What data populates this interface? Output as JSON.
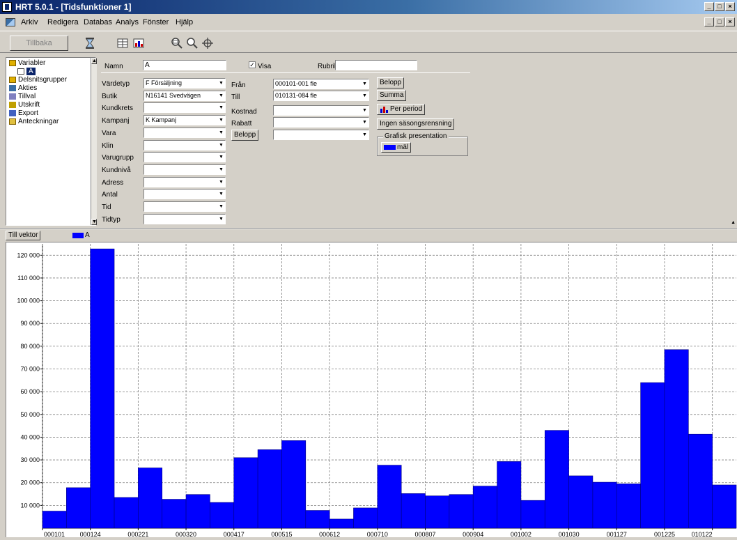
{
  "window": {
    "title": "HRT 5.0.1 - [Tidsfunktioner 1]",
    "controls": [
      "_",
      "□",
      "×"
    ]
  },
  "menu": [
    "Arkiv",
    "Redigera",
    "Databas",
    "Analys",
    "Fönster",
    "Hjälp"
  ],
  "toolbar": {
    "back_label": "Tillbaka"
  },
  "sidebar": {
    "items": [
      {
        "label": "Variabler",
        "icon": "folder-icon"
      },
      {
        "label": "A",
        "icon": "grid-icon",
        "selected": true
      },
      {
        "label": "Delsnitsgrupper",
        "icon": "folder-icon"
      },
      {
        "label": "Akties",
        "icon": "chart-icon"
      },
      {
        "label": "Tillval",
        "icon": "tool-icon"
      },
      {
        "label": "Utskrift",
        "icon": "printer-icon"
      },
      {
        "label": "Export",
        "icon": "export-icon"
      },
      {
        "label": "Anteckningar",
        "icon": "note-icon"
      }
    ]
  },
  "form": {
    "name_label": "Namn",
    "name_value": "A",
    "visa_label": "Visa",
    "visa_checked": true,
    "rubrik_label": "Rubrik",
    "rubrik_value": "",
    "fields": [
      {
        "label": "Värdetyp",
        "value": "F Försäljning"
      },
      {
        "label": "Butik",
        "value": "N16141 Svedvägen"
      },
      {
        "label": "Kundkrets",
        "value": ""
      },
      {
        "label": "Kampanj",
        "value": "K Kampanj"
      },
      {
        "label": "Vara",
        "value": ""
      },
      {
        "label": "Klin",
        "value": ""
      },
      {
        "label": "Varugrupp",
        "value": ""
      },
      {
        "label": "Kundnivå",
        "value": ""
      },
      {
        "label": "Adress",
        "value": ""
      },
      {
        "label": "Antal",
        "value": ""
      },
      {
        "label": "Tid",
        "value": ""
      },
      {
        "label": "Tidtyp",
        "value": ""
      }
    ],
    "fran_label": "Från",
    "fran_value": "000101-001 fle",
    "till_label": "Till",
    "till_value": "010131-084 fle",
    "kostnad_label": "Kostnad",
    "kostnad_value": "",
    "rabatt_label": "Rabatt",
    "rabatt_value": "",
    "belopp_label": "Belopp",
    "belopp_value": "",
    "btn_belopp": "Belopp",
    "btn_summa": "Summa",
    "btn_per_period": "Per period",
    "btn_ingen": "Ingen säsongsrensning",
    "group_title": "Grafisk presentation",
    "swatch_label": "mäl"
  },
  "strip": {
    "button_label": "Till vektor",
    "legend_label": "A"
  },
  "colors": {
    "bar": "#0000ff",
    "selection": "#0a246a",
    "face": "#d4d0c8"
  },
  "chart_data": {
    "type": "bar",
    "title": "",
    "xlabel": "",
    "ylabel": "",
    "ylim": [
      0,
      125000
    ],
    "yticks": [
      10000,
      20000,
      30000,
      40000,
      50000,
      60000,
      70000,
      80000,
      90000,
      100000,
      110000,
      120000
    ],
    "ytick_labels": [
      "10 000",
      "20 000",
      "30 000",
      "40 000",
      "50 000",
      "60 000",
      "70 000",
      "80 000",
      "90 000",
      "100 000",
      "110 000",
      "120 000"
    ],
    "grid": true,
    "xtick_labels": [
      "000101",
      "000124",
      "000221",
      "000320",
      "000417",
      "000515",
      "000612",
      "000710",
      "000807",
      "000904",
      "001002",
      "001030",
      "001127",
      "001225",
      "010122"
    ],
    "series": [
      {
        "name": "A",
        "color": "#0000ff",
        "values": [
          7500,
          17800,
          122800,
          13500,
          26500,
          12700,
          14800,
          11300,
          31000,
          34500,
          38500,
          7800,
          4000,
          8900,
          27700,
          15200,
          14200,
          14800,
          18500,
          29300,
          12200,
          43000,
          23000,
          20200,
          19500,
          64000,
          78500,
          41300,
          19000
        ]
      }
    ]
  }
}
